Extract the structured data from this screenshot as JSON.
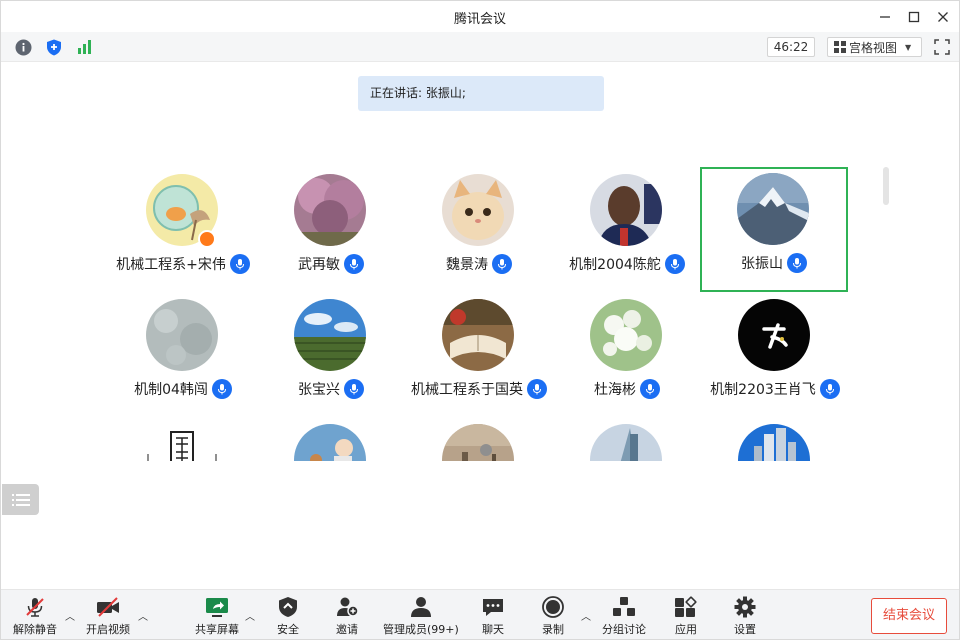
{
  "window": {
    "title": "腾讯会议"
  },
  "infobar": {
    "timer": "46:22",
    "view_label": "宫格视图"
  },
  "speaking": {
    "text": "正在讲话: 张振山;"
  },
  "participants": [
    {
      "name": "机械工程系+宋伟",
      "avatar": "fish-bowl-cartoon",
      "host": true
    },
    {
      "name": "武再敏",
      "avatar": "pink-tree"
    },
    {
      "name": "魏景涛",
      "avatar": "cat"
    },
    {
      "name": "机制2004陈舵",
      "avatar": "basketball-player"
    },
    {
      "name": "张振山",
      "avatar": "snow-mountain",
      "active": true
    },
    {
      "name": "机制04韩闯",
      "avatar": "grey-texture"
    },
    {
      "name": "张宝兴",
      "avatar": "green-field-sky"
    },
    {
      "name": "机械工程系于国英",
      "avatar": "books-apple"
    },
    {
      "name": "杜海彬",
      "avatar": "white-flowers"
    },
    {
      "name": "机制2203王肖飞",
      "avatar": "black-fei-logo"
    },
    {
      "name": "",
      "avatar": "calligraphy-seal"
    },
    {
      "name": "",
      "avatar": "blue-cartoon"
    },
    {
      "name": "",
      "avatar": "street-photo"
    },
    {
      "name": "",
      "avatar": "building-sky"
    },
    {
      "name": "",
      "avatar": "city-towers"
    }
  ],
  "toolbar": {
    "unmute": "解除静音",
    "start_video": "开启视频",
    "share_screen": "共享屏幕",
    "security": "安全",
    "invite": "邀请",
    "manage_members": "管理成员(99+)",
    "chat": "聊天",
    "record": "录制",
    "breakout": "分组讨论",
    "apps": "应用",
    "settings": "设置",
    "end_meeting": "结束会议"
  },
  "colors": {
    "accent": "#1b6ef3",
    "active_border": "#2fb255",
    "end_red": "#e74c3c"
  }
}
